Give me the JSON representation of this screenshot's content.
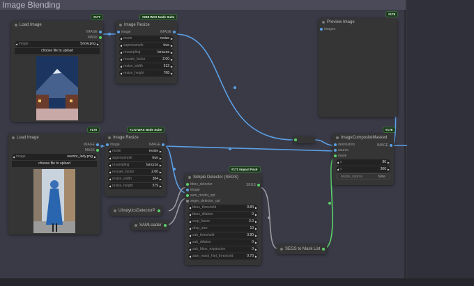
{
  "group": {
    "title": "Image Blending"
  },
  "colors": {
    "image": "#5aa0e6",
    "mask": "#5ad16a",
    "grey": "#9a9aa0"
  },
  "nodes": {
    "load1": {
      "badge": "#177",
      "title": "Load Image",
      "outputs": [
        "IMAGE",
        "MASK"
      ],
      "image_widget": {
        "label": "image",
        "value": "Snow.png"
      },
      "upload": "choose file to upload"
    },
    "resize1": {
      "badge": "#248 WAS Node Suite",
      "title": "Image Resize",
      "input": "image",
      "output": "IMAGE",
      "widgets": [
        {
          "label": "mode",
          "value": "resize"
        },
        {
          "label": "supersample",
          "value": "true"
        },
        {
          "label": "resampling",
          "value": "lanczos"
        },
        {
          "label": "rescale_factor",
          "value": "2.00"
        },
        {
          "label": "resize_width",
          "value": "512"
        },
        {
          "label": "resize_height",
          "value": "768"
        }
      ]
    },
    "preview": {
      "badge": "#179",
      "title": "Preview Image",
      "input": "images"
    },
    "load2": {
      "badge": "#170",
      "title": "Load Image",
      "outputs": [
        "IMAGE",
        "MASK"
      ],
      "image_widget": {
        "label": "image",
        "value": "warrior_lady.png"
      },
      "upload": "choose file to upload"
    },
    "resize2": {
      "badge": "#172 WAS Node Suite",
      "title": "Image Resize",
      "input": "image",
      "output": "IMAGE",
      "widgets": [
        {
          "label": "mode",
          "value": "resize"
        },
        {
          "label": "supersample",
          "value": "true"
        },
        {
          "label": "resampling",
          "value": "lanczos"
        },
        {
          "label": "rescale_factor",
          "value": "2.00"
        },
        {
          "label": "resize_width",
          "value": "384"
        },
        {
          "label": "resize_height",
          "value": "579"
        }
      ]
    },
    "ultra": {
      "title": "UltralyticsDetectorP"
    },
    "sam": {
      "title": "SAMLoader"
    },
    "detector": {
      "badge": "#171 Impact Pack",
      "title": "Simple Detector (SEGS)",
      "inputs": [
        "bbox_detector",
        "image",
        "sam_model_opt",
        "segm_detector_opt"
      ],
      "output": "SEGS",
      "widgets": [
        {
          "label": "bbox_threshold",
          "value": "0.84"
        },
        {
          "label": "bbox_dilation",
          "value": "0"
        },
        {
          "label": "crop_factor",
          "value": "3.0"
        },
        {
          "label": "drop_size",
          "value": "10"
        },
        {
          "label": "sub_threshold",
          "value": "0.80"
        },
        {
          "label": "sub_dilation",
          "value": "0"
        },
        {
          "label": "sub_bbox_expansion",
          "value": "0"
        },
        {
          "label": "sam_mask_hint_threshold",
          "value": "0.70"
        }
      ]
    },
    "segs2mask": {
      "title": "SEGS to Mask List"
    },
    "composite": {
      "badge": "#178",
      "title": "ImageCompositeMasked",
      "inputs": [
        "destination",
        "source",
        "mask"
      ],
      "output": "IMAGE",
      "widgets": [
        {
          "label": "x",
          "value": "80"
        },
        {
          "label": "y",
          "value": "300"
        }
      ],
      "toggle": {
        "label": "resize_source",
        "value": "false"
      }
    }
  }
}
